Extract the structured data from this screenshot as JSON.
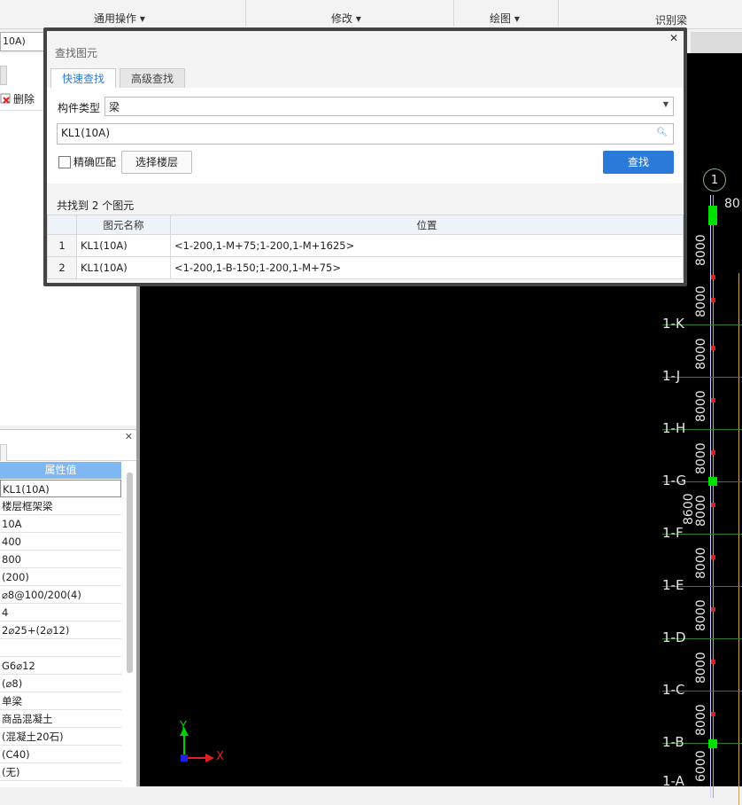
{
  "ribbon": {
    "groups": [
      "通用操作",
      "修改",
      "绘图",
      "识别梁"
    ]
  },
  "left": {
    "combo_value": "10A)",
    "delete_label": "删除"
  },
  "props": {
    "header": "属性值",
    "rows": [
      "KL1(10A)",
      "楼层框架梁",
      "10A",
      "400",
      "800",
      "(200)",
      "⌀8@100/200(4)",
      "4",
      "2⌀25+(2⌀12)",
      "",
      "G6⌀12",
      "(⌀8)",
      "单梁",
      "商品混凝土",
      "(混凝土20石)",
      "(C40)",
      "(无)"
    ]
  },
  "dialog": {
    "title": "查找图元",
    "tabs": [
      "快速查找",
      "高级查找"
    ],
    "type_label": "构件类型",
    "type_value": "梁",
    "search_value": "KL1(10A)",
    "exact_label": "精确匹配",
    "floor_button": "选择楼层",
    "find_button": "查找",
    "result_count": "共找到 2 个图元",
    "columns": [
      "图元名称",
      "位置"
    ],
    "results": [
      {
        "idx": "1",
        "name": "KL1(10A)",
        "pos": "<1-200,1-M+75;1-200,1-M+1625>"
      },
      {
        "idx": "2",
        "name": "KL1(10A)",
        "pos": "<1-200,1-B-150;1-200,1-M+75>"
      }
    ]
  },
  "canvas": {
    "axis_top": "1",
    "axis_top_dim": "80",
    "axis_labels": [
      "1-K",
      "1-J",
      "1-H",
      "1-G",
      "1-F",
      "1-E",
      "1-D",
      "1-C",
      "1-B",
      "1-A"
    ],
    "dims": [
      "8000",
      "8000",
      "8000",
      "8000",
      "8000",
      "8000",
      "8000",
      "8000",
      "8000",
      "8000",
      "6000"
    ],
    "extra_dim": "8600",
    "ucs_y": "Y",
    "ucs_x": "X",
    "colors": {
      "grid": "#2e7a2e",
      "node": "#00e000",
      "mark": "#e02020",
      "beam": "#9b9bff"
    }
  }
}
